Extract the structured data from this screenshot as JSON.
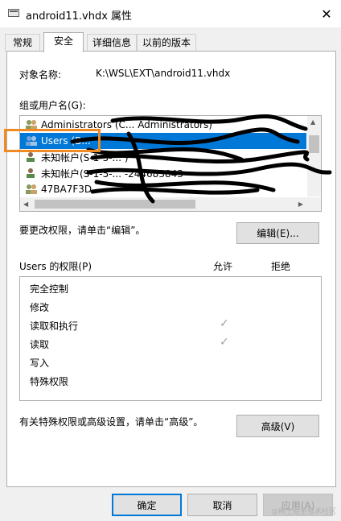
{
  "window": {
    "title": "android11.vhdx 属性",
    "close_glyph": "✕"
  },
  "tabs": [
    {
      "label": "常规"
    },
    {
      "label": "安全"
    },
    {
      "label": "详细信息"
    },
    {
      "label": "以前的版本"
    }
  ],
  "object_name": {
    "label": "对象名称:",
    "value": "K:\\WSL\\EXT\\android11.vhdx"
  },
  "groups": {
    "label": "组或用户名(G):",
    "items": [
      {
        "text": "Administrators (C...                     Administrators)"
      },
      {
        "text": "Users (B..."
      },
      {
        "text": "未知帐户(S-1-5-...                  )"
      },
      {
        "text": "未知帐户(S-1-5-...                  -244683843"
      },
      {
        "text": "47BA7F3D..."
      }
    ]
  },
  "edit": {
    "hint": "要更改权限，请单击“编辑”。",
    "button": "编辑(E)..."
  },
  "permissions": {
    "header": "Users 的权限(P)",
    "allow": "允许",
    "deny": "拒绝",
    "rows": [
      {
        "name": "完全控制",
        "allow": false
      },
      {
        "name": "修改",
        "allow": false
      },
      {
        "name": "读取和执行",
        "allow": true
      },
      {
        "name": "读取",
        "allow": true
      },
      {
        "name": "写入",
        "allow": false
      },
      {
        "name": "特殊权限",
        "allow": false
      }
    ],
    "check_glyph": "✓"
  },
  "advanced": {
    "hint": "有关特殊权限或高级设置，请单击“高级”。",
    "button": "高级(V)"
  },
  "footer": {
    "ok": "确定",
    "cancel": "取消",
    "apply": "应用(A)"
  },
  "watermark": "@稀土掘金技术社区",
  "colors": {
    "selection": "#0078d7",
    "highlight_box": "#f08a24"
  }
}
